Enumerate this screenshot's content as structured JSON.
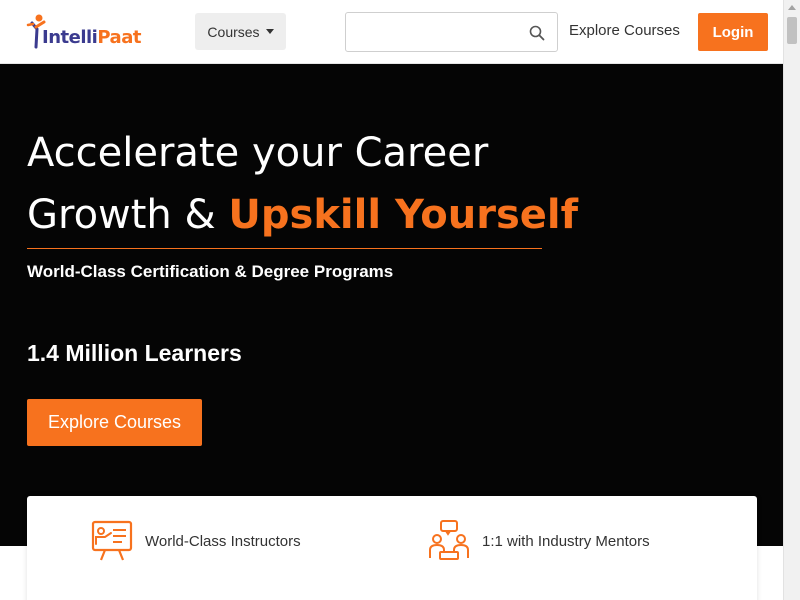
{
  "header": {
    "logo_part1": "Intelli",
    "logo_part2": "Paat",
    "courses_label": "Courses",
    "search_placeholder": "",
    "search_value": "",
    "nav_explore_label": "Explore Courses",
    "login_label": "Login"
  },
  "hero": {
    "title_line1": "Accelerate your Career",
    "title_line2_prefix": "Growth & ",
    "title_highlight": "Upskill Yourself",
    "subtitle": "World-Class Certification & Degree Programs",
    "learners": "1.4 Million Learners",
    "cta_label": "Explore Courses"
  },
  "features": [
    {
      "icon": "instructor-icon",
      "label": "World-Class Instructors"
    },
    {
      "icon": "mentor-icon",
      "label": "1:1 with Industry Mentors"
    }
  ],
  "colors": {
    "accent": "#f7721e",
    "brand_blue": "#3b3b8f",
    "hero_bg": "#050505",
    "text_dark": "#333333"
  }
}
